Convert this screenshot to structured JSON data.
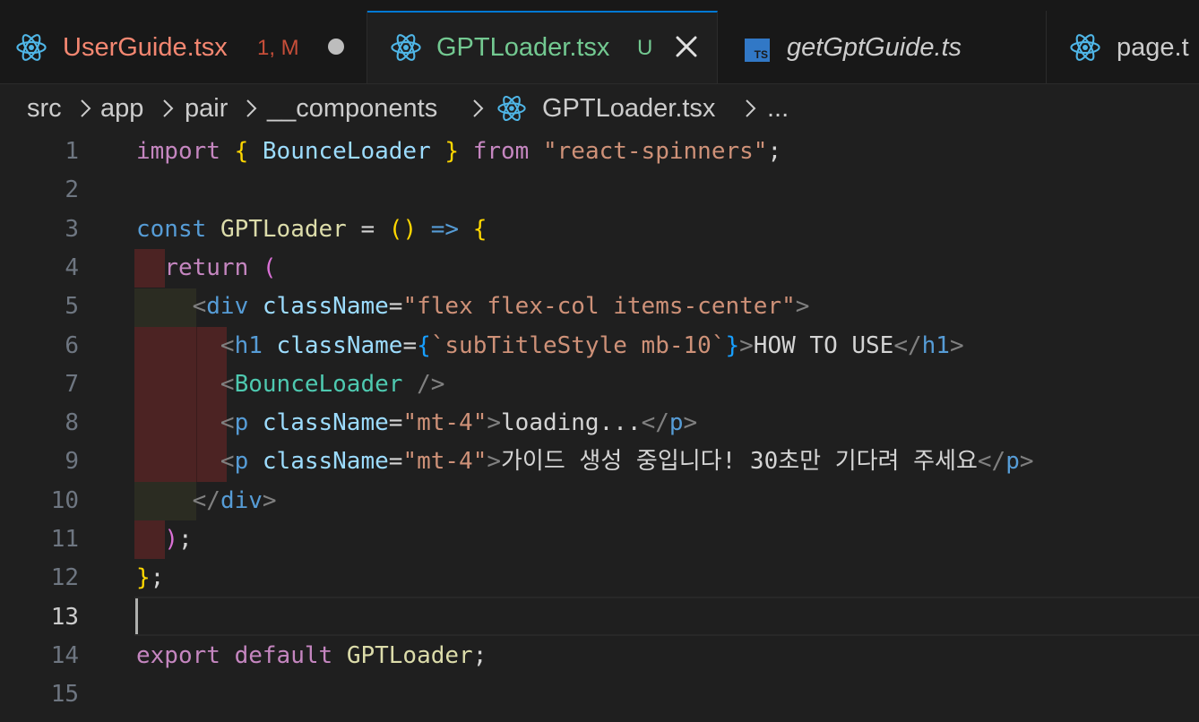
{
  "tabs": [
    {
      "name": "UserGuide.tsx",
      "status": "1, M",
      "icon": "react-icon",
      "color": "#f48771",
      "status_color": "#c74e39",
      "dirty": true
    },
    {
      "name": "GPTLoader.tsx",
      "status": "U",
      "icon": "react-icon",
      "color": "#73c991",
      "status_color": "#73c991",
      "active": true
    },
    {
      "name": "getGptGuide.ts",
      "icon": "typescript-icon",
      "color": "#cccccc",
      "italic": true
    },
    {
      "name": "page.t",
      "icon": "react-icon",
      "color": "#cccccc"
    }
  ],
  "breadcrumb": [
    "src",
    "app",
    "pair",
    "__components",
    "GPTLoader.tsx",
    "..."
  ],
  "colors": {
    "react": "#4fb6e7",
    "accent": "#0078d4",
    "ts": "#3178c6"
  },
  "line_numbers": [
    "1",
    "2",
    "3",
    "4",
    "5",
    "6",
    "7",
    "8",
    "9",
    "10",
    "11",
    "12",
    "13",
    "14",
    "15"
  ],
  "current_line": "13",
  "code": {
    "l1": {
      "a": "import",
      "b": "{",
      "c": "BounceLoader",
      "d": "}",
      "e": "from",
      "f": "\"react-spinners\"",
      "g": ";"
    },
    "l3": {
      "a": "const",
      "b": "GPTLoader",
      "c": "=",
      "d": "()",
      "e": "=>",
      "f": "{"
    },
    "l4": {
      "a": "return",
      "b": "("
    },
    "l5": {
      "a": "<",
      "b": "div",
      "c": "className",
      "d": "=",
      "e": "\"flex flex-col items-center\"",
      "f": ">"
    },
    "l6": {
      "a": "<",
      "b": "h1",
      "c": "className",
      "d": "=",
      "e": "{",
      "f": "`subTitleStyle mb-10`",
      "g": "}",
      "h": ">",
      "i": "HOW TO USE",
      "j": "</",
      "k": "h1",
      "l": ">"
    },
    "l7": {
      "a": "<",
      "b": "BounceLoader",
      "c": " />"
    },
    "l8": {
      "a": "<",
      "b": "p",
      "c": "className",
      "d": "=",
      "e": "\"mt-4\"",
      "f": ">",
      "g": "loading...",
      "h": "</",
      "i": "p",
      "j": ">"
    },
    "l9": {
      "a": "<",
      "b": "p",
      "c": "className",
      "d": "=",
      "e": "\"mt-4\"",
      "f": ">",
      "g": "가이드 생성 중입니다! 30초만 기다려 주세요",
      "h": "</",
      "i": "p",
      "j": ">"
    },
    "l10": {
      "a": "</",
      "b": "div",
      "c": ">"
    },
    "l11": {
      "a": ")",
      "b": ";"
    },
    "l12": {
      "a": "}",
      "b": ";"
    },
    "l14": {
      "a": "export",
      "b": "default",
      "c": "GPTLoader",
      "d": ";"
    }
  }
}
